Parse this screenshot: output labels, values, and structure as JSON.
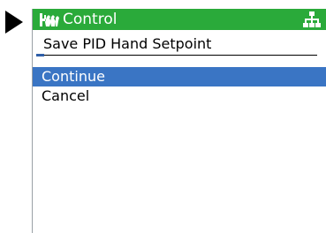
{
  "titlebar": {
    "title": "Control",
    "title_icon": "hands-icon",
    "status_icon": "network-icon",
    "background": "#2aaa3a"
  },
  "dialog": {
    "subtitle": "Save PID Hand Setpoint"
  },
  "progress": {
    "fraction": 0.03,
    "color": "#2f5fa8"
  },
  "menu": {
    "items": [
      {
        "label": "Continue",
        "selected": true
      },
      {
        "label": "Cancel",
        "selected": false
      }
    ],
    "selection_color": "#3a75c4"
  },
  "pointer_icon": "triangle-pointer-icon"
}
